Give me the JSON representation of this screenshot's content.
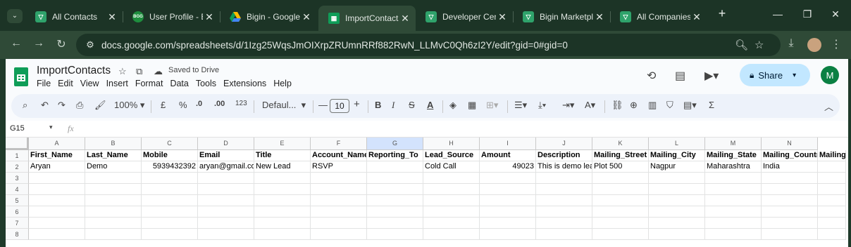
{
  "browser": {
    "tabs": [
      {
        "title": "All Contacts",
        "icon": "bigin-icon"
      },
      {
        "title": "User Profile - Bigin",
        "icon": "bigin-badge-icon",
        "badge": "BGG"
      },
      {
        "title": "Bigin - Google Drive",
        "icon": "google-drive-icon"
      },
      {
        "title": "ImportContacts",
        "icon": "google-sheets-icon"
      },
      {
        "title": "Developer Center",
        "icon": "bigin-icon"
      },
      {
        "title": "Bigin Marketplace",
        "icon": "bigin-marketplace-icon"
      },
      {
        "title": "All Companies",
        "icon": "bigin-icon"
      }
    ],
    "active_tab": 3,
    "url": "docs.google.com/spreadsheets/d/1Izg25WqsJmOIXrpZRUmnRRf882RwN_LLMvC0Qh6zI2Y/edit?gid=0#gid=0"
  },
  "sheet": {
    "title": "ImportContacts",
    "save_status": "Saved to Drive",
    "menus": [
      "File",
      "Edit",
      "View",
      "Insert",
      "Format",
      "Data",
      "Tools",
      "Extensions",
      "Help"
    ],
    "share_label": "Share",
    "avatar_initial": "M",
    "toolbar": {
      "zoom": "100%",
      "currency": "£",
      "percent": "%",
      "dec_decrease": ".0",
      "dec_increase": ".00",
      "number_format": "123",
      "font": "Defaul...",
      "font_size": "10"
    },
    "name_box": "G15",
    "fx": "fx",
    "columns": [
      "A",
      "B",
      "C",
      "D",
      "E",
      "F",
      "G",
      "H",
      "I",
      "J",
      "K",
      "L",
      "M",
      "N"
    ],
    "rows": [
      [
        "First_Name",
        "Last_Name",
        "Mobile",
        "Email",
        "Title",
        "Account_Name",
        "Reporting_To",
        "Lead_Source",
        "Amount",
        "Description",
        "Mailing_Street",
        "Mailing_City",
        "Mailing_State",
        "Mailing_Country",
        "Mailing"
      ],
      [
        "Aryan",
        "Demo",
        "5939432392",
        "aryan@gmail.com",
        "New Lead",
        "RSVP",
        "",
        "Cold Call",
        "49023",
        "This is demo lead",
        "Plot 500",
        "Nagpur",
        "Maharashtra",
        "India",
        ""
      ]
    ],
    "row_numbers": [
      "1",
      "2",
      "3",
      "4",
      "5",
      "6",
      "7",
      "8"
    ]
  }
}
